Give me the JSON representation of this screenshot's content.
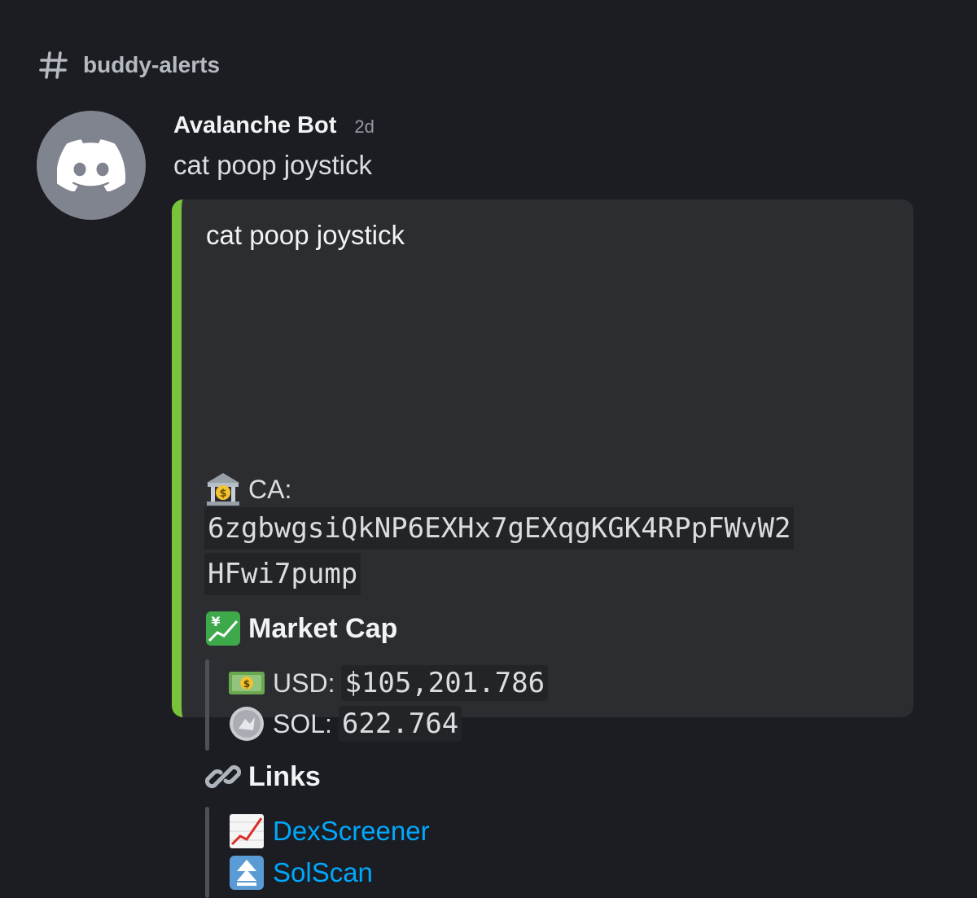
{
  "channel": {
    "name": "buddy-alerts",
    "icon": "hash-icon"
  },
  "message": {
    "author": "Avalanche Bot",
    "timestamp": "2d",
    "content": "cat poop joystick",
    "avatar_icon": "discord-logo-icon",
    "avatar_color": "#80848e"
  },
  "embed": {
    "accent_color": "#78c33b",
    "title": "cat poop joystick",
    "ca_label": "CA:",
    "ca_icon": "bank-icon",
    "ca_line1": "6zgbwgsiQkNP6EXHx7gEXqgKGK4RPpFWvW2",
    "ca_line2": "HFwi7pump",
    "market_cap": {
      "title": "Market Cap",
      "icon": "yen-chart-icon",
      "usd_label": "USD:",
      "usd_value": "$105,201.786",
      "usd_icon": "dollar-banknote-icon",
      "sol_label": "SOL:",
      "sol_value": "622.764",
      "sol_icon": "coin-icon"
    },
    "links": {
      "title": "Links",
      "icon": "link-icon",
      "dexscreener_label": "DexScreener",
      "dexscreener_icon": "chart-increasing-icon",
      "solscan_label": "SolScan",
      "solscan_icon": "double-up-arrow-icon",
      "link_color": "#00a8fc"
    }
  }
}
